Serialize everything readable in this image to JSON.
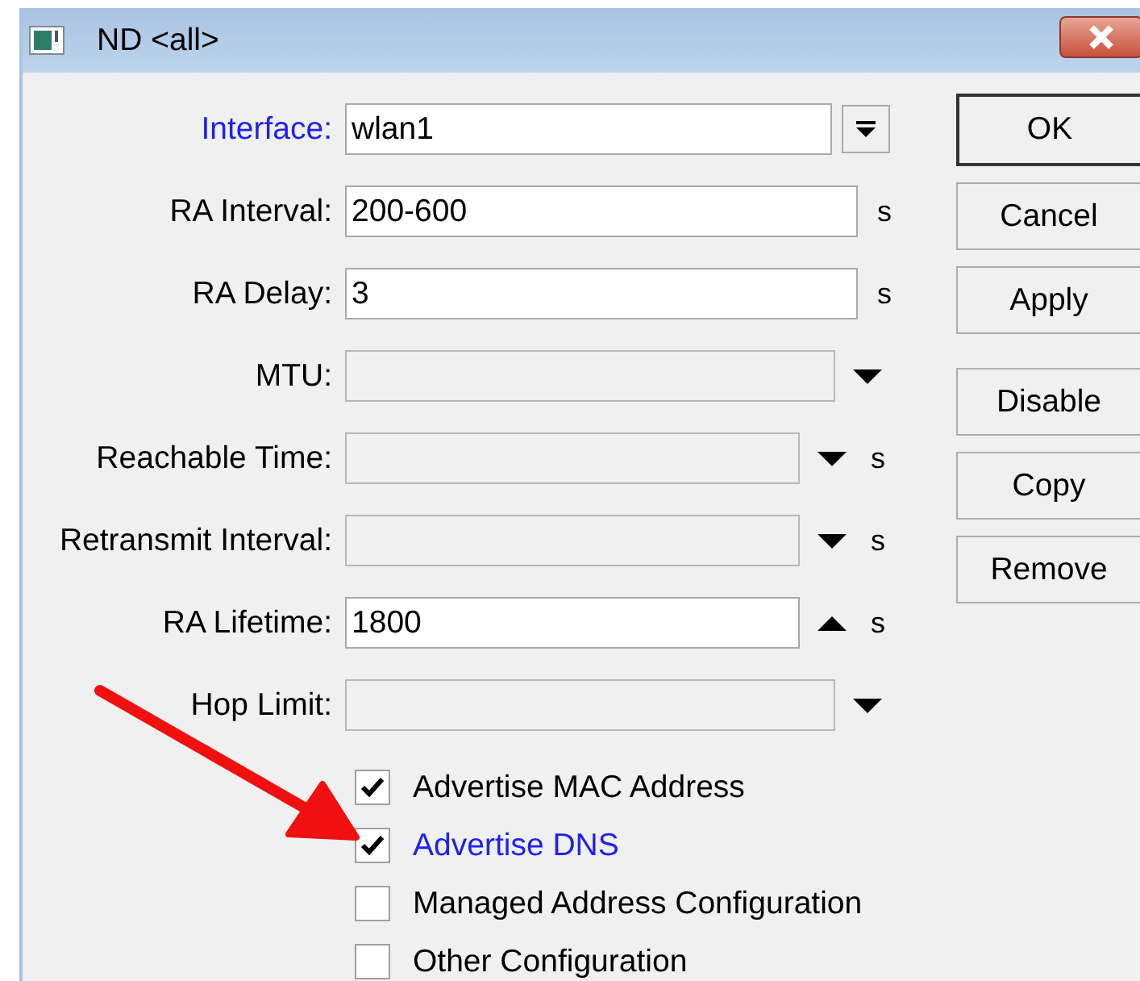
{
  "window": {
    "title": "ND <all>"
  },
  "fields": [
    {
      "label": "Interface:",
      "highlighted": true,
      "value": "wlan1",
      "enabled": true,
      "kind": "dropdown-button"
    },
    {
      "label": "RA Interval:",
      "highlighted": false,
      "value": "200-600",
      "enabled": true,
      "kind": "plain",
      "unit": "s"
    },
    {
      "label": "RA Delay:",
      "highlighted": false,
      "value": "3",
      "enabled": true,
      "kind": "plain",
      "unit": "s"
    },
    {
      "label": "MTU:",
      "highlighted": false,
      "enabled": false,
      "kind": "down-arrow"
    },
    {
      "label": "Reachable Time:",
      "highlighted": false,
      "enabled": false,
      "kind": "down-arrow",
      "unit": "s"
    },
    {
      "label": "Retransmit Interval:",
      "highlighted": false,
      "enabled": false,
      "kind": "down-arrow",
      "unit": "s"
    },
    {
      "label": "RA Lifetime:",
      "highlighted": false,
      "value": "1800",
      "enabled": true,
      "kind": "up-arrow",
      "unit": "s"
    },
    {
      "label": "Hop Limit:",
      "highlighted": false,
      "enabled": false,
      "kind": "down-arrow"
    }
  ],
  "checkboxes": [
    {
      "label": "Advertise MAC Address",
      "checked": true,
      "highlighted": false
    },
    {
      "label": "Advertise DNS",
      "checked": true,
      "highlighted": true
    },
    {
      "label": "Managed Address Configuration",
      "checked": false,
      "highlighted": false
    },
    {
      "label": "Other Configuration",
      "checked": false,
      "highlighted": false
    }
  ],
  "buttons": [
    {
      "label": "OK",
      "default": true
    },
    {
      "label": "Cancel",
      "default": false
    },
    {
      "label": "Apply",
      "default": false
    }
  ],
  "action_buttons": [
    {
      "label": "Disable"
    },
    {
      "label": "Copy"
    },
    {
      "label": "Remove"
    }
  ]
}
